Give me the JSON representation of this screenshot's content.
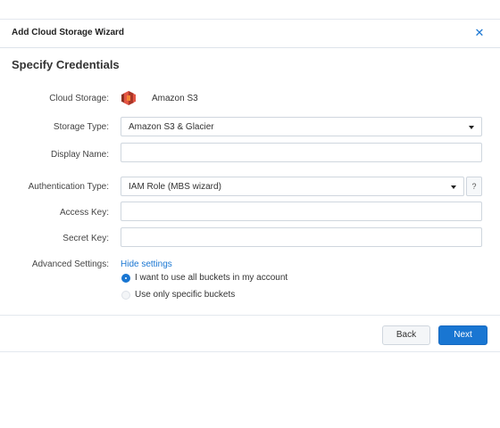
{
  "wizard": {
    "title": "Add Cloud Storage Wizard",
    "close_icon": "close-icon",
    "close_glyph": "✕",
    "section_title": "Specify Credentials"
  },
  "form": {
    "cloud_storage": {
      "label": "Cloud Storage:",
      "value": "Amazon S3",
      "icon": "amazon-s3-icon",
      "icon_color": "#d13212"
    },
    "storage_type": {
      "label": "Storage Type:",
      "value": "Amazon S3 & Glacier"
    },
    "display_name": {
      "label": "Display Name:",
      "value": ""
    },
    "authentication_type": {
      "label": "Authentication Type:",
      "value": "IAM Role (MBS wizard)",
      "help_label": "?"
    },
    "access_key": {
      "label": "Access Key:",
      "value": ""
    },
    "secret_key": {
      "label": "Secret Key:",
      "value": ""
    },
    "advanced_settings": {
      "label": "Advanced Settings:",
      "toggle_link": "Hide settings",
      "options": [
        {
          "label": "I want to use all buckets in my account",
          "checked": true
        },
        {
          "label": "Use only specific buckets",
          "checked": false
        }
      ]
    }
  },
  "footer": {
    "back_label": "Back",
    "next_label": "Next"
  },
  "colors": {
    "accent": "#1976d2",
    "border": "#cfd6de",
    "divider": "#e3e8ee"
  }
}
